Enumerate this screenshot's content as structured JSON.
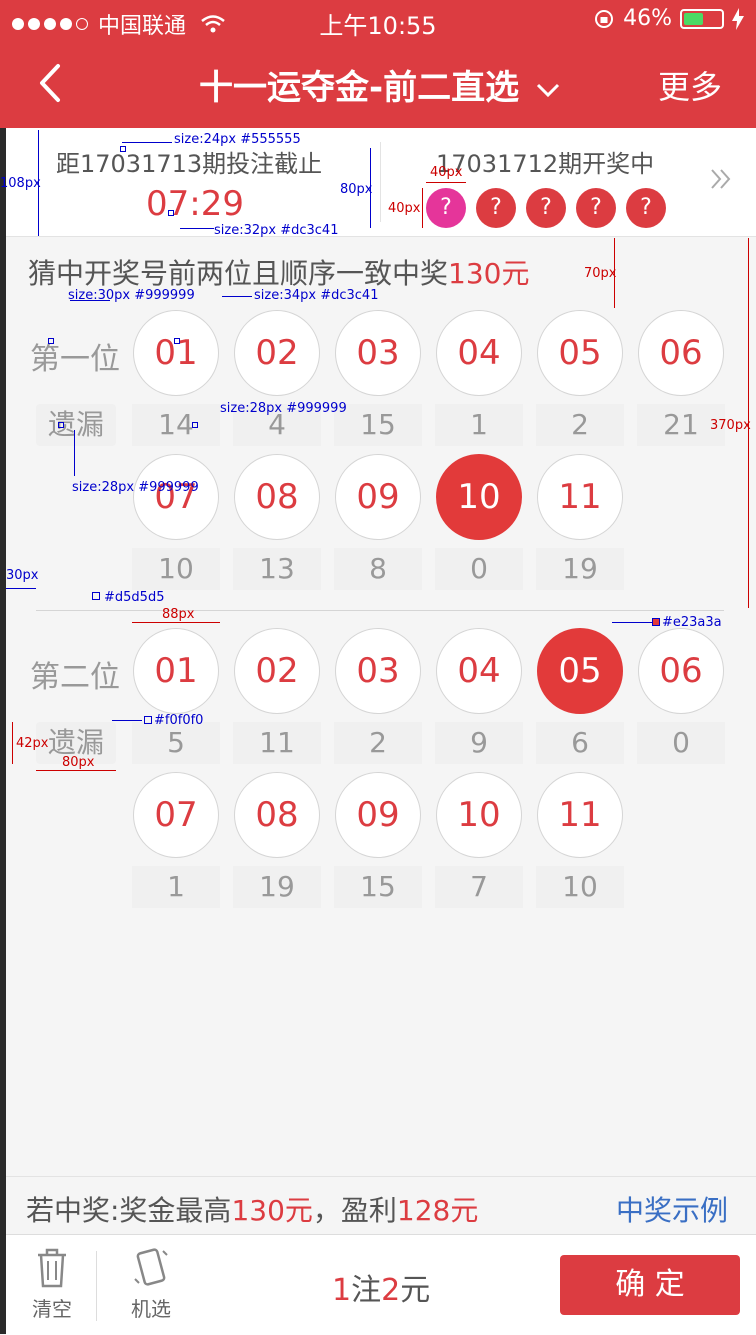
{
  "status_bar": {
    "carrier": "中国联通",
    "time": "上午10:55",
    "battery_pct": "46%"
  },
  "nav": {
    "title": "十一运夺金-前二直选",
    "more_label": "更多"
  },
  "info": {
    "deadline_label": "距17031713期投注截止",
    "countdown": "07:29",
    "draw_label": "17031712期开奖中",
    "draw_balls": [
      "?",
      "?",
      "?",
      "?",
      "?"
    ]
  },
  "rule_text_prefix": "猜中开奖号前两位且顺序一致中奖",
  "rule_prize": "130元",
  "positions": [
    {
      "label": "第一位",
      "miss_label": "遗漏",
      "numbers": [
        "01",
        "02",
        "03",
        "04",
        "05",
        "06",
        "07",
        "08",
        "09",
        "10",
        "11"
      ],
      "misses": [
        "14",
        "4",
        "15",
        "1",
        "2",
        "21",
        "10",
        "13",
        "8",
        "0",
        "19"
      ],
      "selected": "10"
    },
    {
      "label": "第二位",
      "miss_label": "遗漏",
      "numbers": [
        "01",
        "02",
        "03",
        "04",
        "05",
        "06",
        "07",
        "08",
        "09",
        "10",
        "11"
      ],
      "misses": [
        "5",
        "11",
        "2",
        "9",
        "6",
        "0",
        "1",
        "19",
        "15",
        "7",
        "10"
      ],
      "selected": "05"
    }
  ],
  "annotations": {
    "a1": "size:24px  #555555",
    "a2": "size:32px #dc3c41",
    "a3": "size:30px #999999",
    "a4": "size:34px #dc3c41",
    "a5": "size:28px #999999",
    "a6": "size:28px #999999",
    "a7": "#d5d5d5",
    "a8": "#e23a3a",
    "a9": "#f0f0f0",
    "d108": "108px",
    "d80": "80px",
    "d40w": "40px",
    "d40h": "40px",
    "d70": "70px",
    "d370": "370px",
    "d30": "30px",
    "d88": "88px",
    "d42": "42px",
    "d80b": "80px"
  },
  "summary": {
    "prefix": "若中奖:奖金最高",
    "max_prize": "130元",
    "sep": "，盈利",
    "profit": "128元",
    "example_link": "中奖示例"
  },
  "bottom": {
    "clear_label": "清空",
    "random_label": "机选",
    "bets_num": "1",
    "bets_unit": "注",
    "amount_num": "2",
    "amount_unit": "元",
    "confirm_label": "确 定"
  },
  "colors": {
    "brand_red": "#dc3c41",
    "selected_ball": "#e23a3a",
    "ball_border": "#d5d5d5",
    "miss_bg": "#f0f0f0",
    "link_blue": "#3a6fc4"
  }
}
